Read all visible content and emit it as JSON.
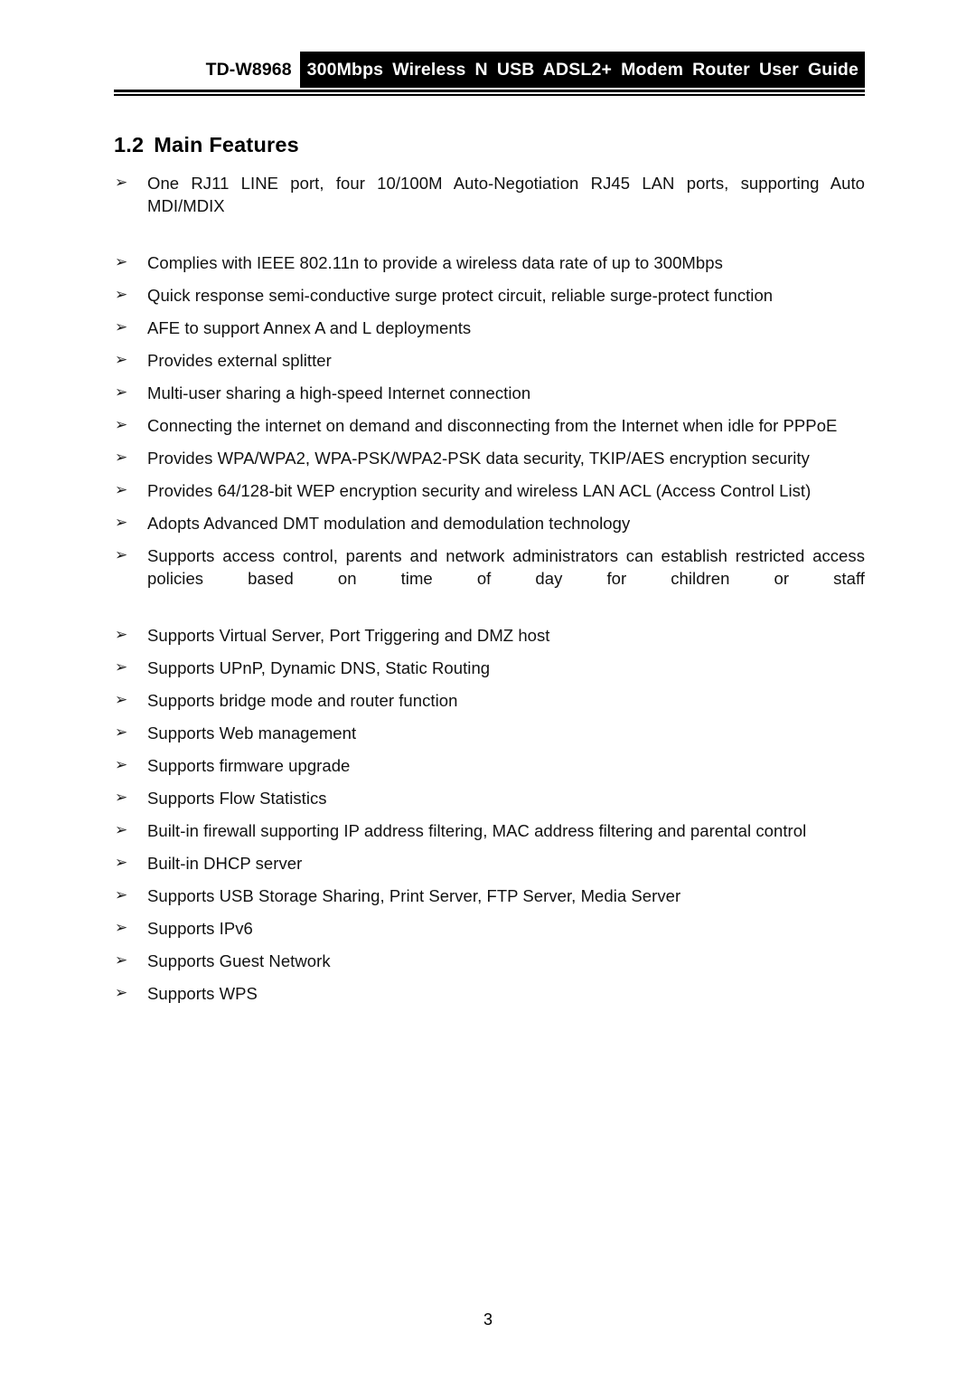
{
  "document": {
    "page_number": "3",
    "header": {
      "model": "TD-W8968",
      "title": "300Mbps Wireless N USB ADSL2+ Modem Router User Guide"
    },
    "section": {
      "number": "1.2",
      "title": "Main Features"
    },
    "bullet_glyph": "➢",
    "features": [
      {
        "text": "One RJ11 LINE port, four 10/100M Auto-Negotiation RJ45 LAN ports, supporting Auto MDI/MDIX",
        "wraps": true
      },
      {
        "text": "Complies with IEEE 802.11n to provide a wireless data rate of up to 300Mbps",
        "wraps": false
      },
      {
        "text": "Quick response semi-conductive surge protect circuit, reliable surge-protect function",
        "wraps": false
      },
      {
        "text": "AFE to support Annex A and L deployments",
        "wraps": false
      },
      {
        "text": "Provides external splitter",
        "wraps": false
      },
      {
        "text": "Multi-user sharing a high-speed Internet connection",
        "wraps": false
      },
      {
        "text": "Connecting the internet on demand and disconnecting from the Internet when idle for PPPoE",
        "wraps": false
      },
      {
        "text": "Provides WPA/WPA2, WPA-PSK/WPA2-PSK data security, TKIP/AES encryption security",
        "wraps": false
      },
      {
        "text": "Provides 64/128-bit WEP encryption security and wireless LAN ACL (Access Control List)",
        "wraps": false
      },
      {
        "text": "Adopts Advanced DMT modulation and demodulation technology",
        "wraps": false
      },
      {
        "text": "Supports access control, parents and network administrators can establish restricted access policies based on time of day for children or staff",
        "wraps": true
      },
      {
        "text": "Supports Virtual Server, Port Triggering and DMZ host",
        "wraps": false
      },
      {
        "text": "Supports UPnP, Dynamic DNS, Static Routing",
        "wraps": false
      },
      {
        "text": "Supports bridge mode and router function",
        "wraps": false
      },
      {
        "text": "Supports Web management",
        "wraps": false
      },
      {
        "text": "Supports firmware upgrade",
        "wraps": false
      },
      {
        "text": "Supports Flow Statistics",
        "wraps": false
      },
      {
        "text": "Built-in firewall supporting IP address filtering, MAC address filtering and parental control",
        "wraps": false
      },
      {
        "text": "Built-in DHCP server",
        "wraps": false
      },
      {
        "text": "Supports USB Storage Sharing, Print Server, FTP Server, Media Server",
        "wraps": false
      },
      {
        "text": "Supports IPv6",
        "wraps": false
      },
      {
        "text": "Supports Guest Network",
        "wraps": false
      },
      {
        "text": "Supports WPS",
        "wraps": false
      }
    ]
  }
}
